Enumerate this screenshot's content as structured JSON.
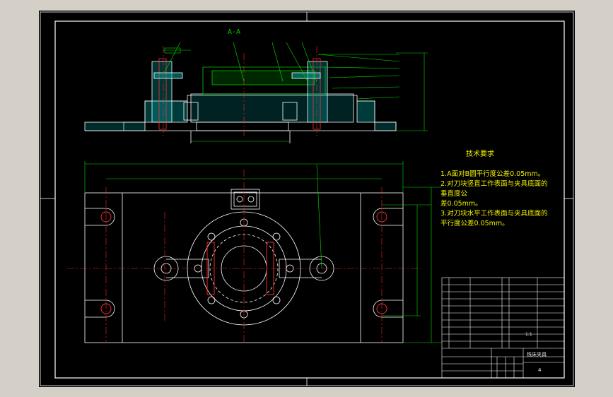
{
  "section_label": "A-A",
  "tech_requirements": {
    "title": "技术要求",
    "lines": [
      "1.A面对B圆平行度公差0.05mm。",
      "2.对刀块竖直工作表面与夹具底面的",
      "垂直度公",
      "差0.05mm。",
      "3.对刀块水平工作表面与夹具底面的",
      "平行度公差0.05mm。"
    ]
  },
  "title_block": {
    "part_name": "铣床夹具",
    "scale": "1:1",
    "drawing_no": "4"
  },
  "colors": {
    "frame": "#ffffff",
    "outline": "#ffffff",
    "center_line": "#ff2020",
    "dimension": "#00e000",
    "hatch": "#00c0c0",
    "note_text": "#f0f000"
  }
}
